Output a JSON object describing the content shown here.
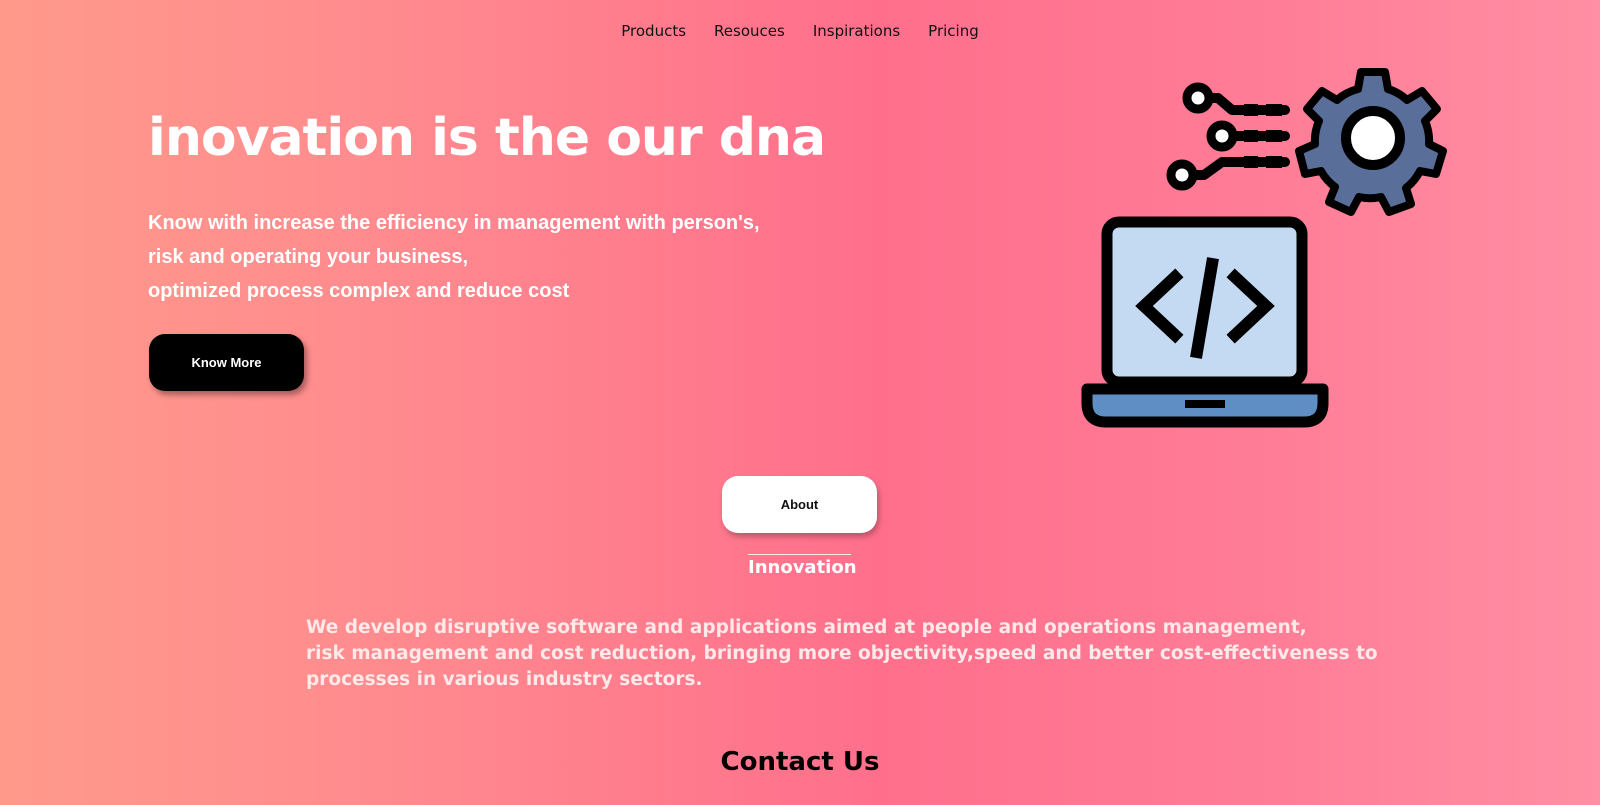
{
  "nav": {
    "items": [
      "Products",
      "Resouces",
      "Inspirations",
      "Pricing"
    ]
  },
  "hero": {
    "title": "inovation is the our dna",
    "lines": [
      "Know with increase the efficiency in management with person's,",
      "risk and operating your business,",
      "optimized process complex and reduce cost"
    ],
    "cta_label": "Know More",
    "illustration": [
      "circuit-gear-icon",
      "laptop-code-icon"
    ]
  },
  "about": {
    "button_label": "About",
    "title": "Innovation",
    "lines": [
      "We develop disruptive software and applications aimed at people and operations management,",
      "risk management and cost reduction, bringing more objectivity,speed and better cost-effectiveness to",
      "processes in various industry sectors."
    ]
  },
  "contact": {
    "title": "Contact Us"
  },
  "colors": {
    "gradient_left": "#ff9a8b",
    "gradient_mid": "#ff6f8c",
    "gradient_right": "#ff8fa4",
    "gear": "#5a6e9a",
    "laptop_screen": "#c3daf2",
    "laptop_base": "#5f8ec4"
  }
}
